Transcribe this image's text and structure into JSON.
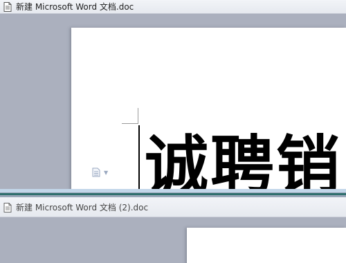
{
  "windows": [
    {
      "title": "新建 Microsoft Word 文档.doc",
      "icon": "word-document-icon",
      "content": {
        "headline": "诚聘销"
      },
      "paste_options_icon": "paste-options-icon"
    },
    {
      "title": "新建 Microsoft Word 文档 (2).doc",
      "icon": "word-document-icon"
    }
  ],
  "colors": {
    "workspace": "#abb0be",
    "page": "#ffffff",
    "splitter_accent": "#2f6f6e"
  }
}
